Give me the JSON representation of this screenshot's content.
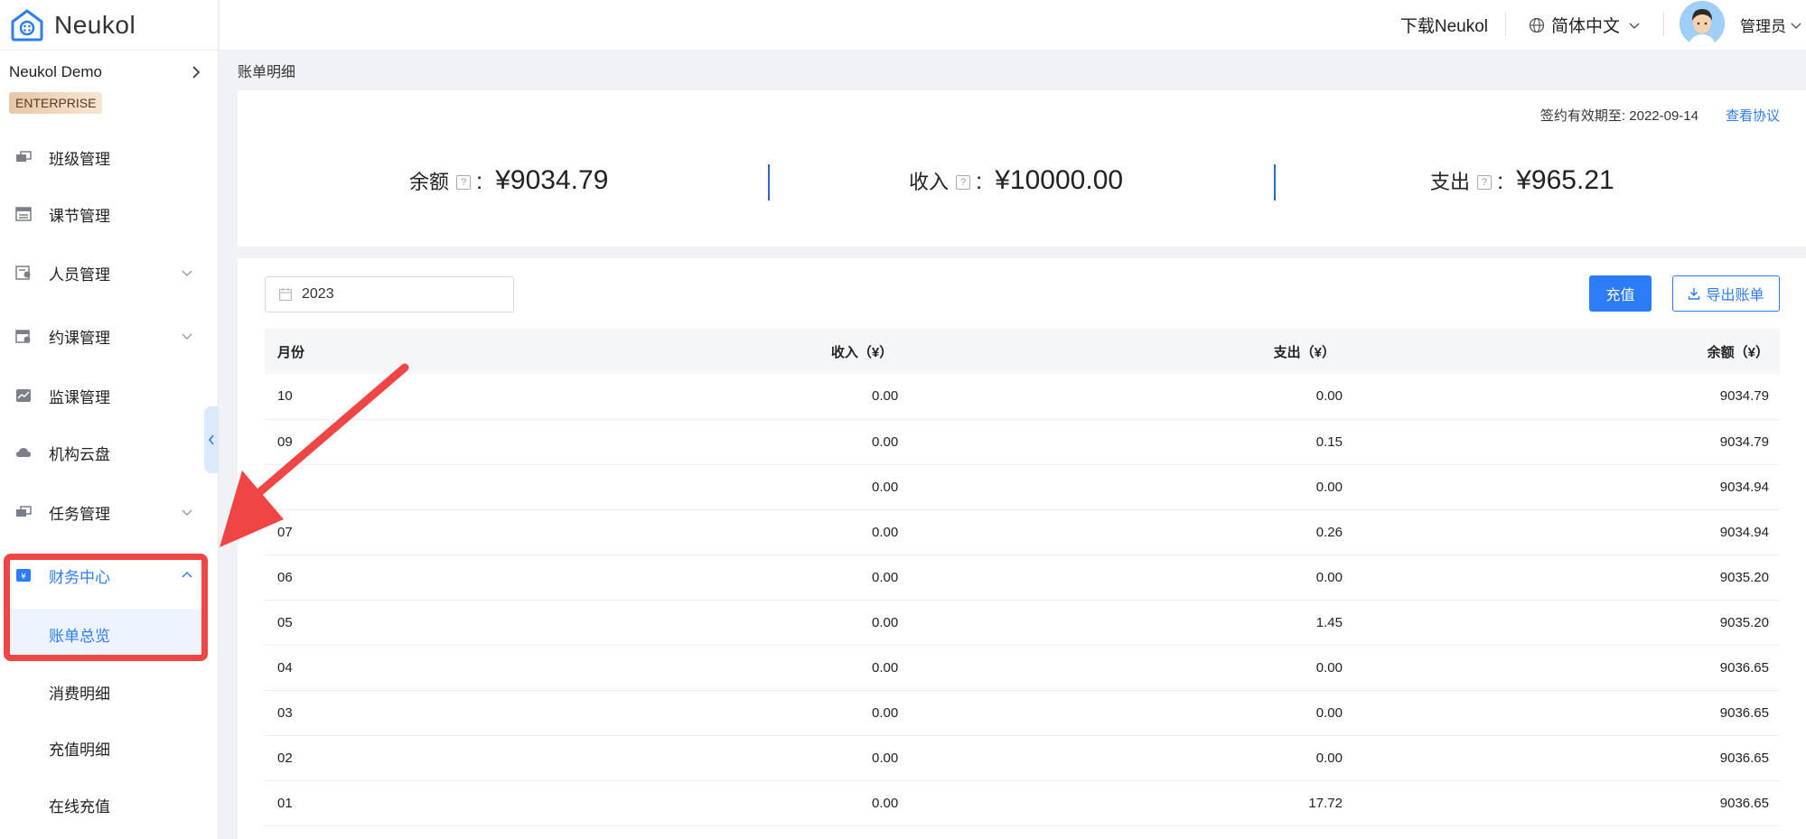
{
  "brand": {
    "name": "Neukol"
  },
  "sidebar": {
    "org_name": "Neukol Demo",
    "badge": "ENTERPRISE",
    "items": [
      {
        "label": "班级管理",
        "icon": "class-icon",
        "has_arrow": false
      },
      {
        "label": "课节管理",
        "icon": "lesson-icon",
        "has_arrow": false
      },
      {
        "label": "人员管理",
        "icon": "people-icon",
        "has_arrow": true
      },
      {
        "label": "约课管理",
        "icon": "booking-icon",
        "has_arrow": true
      },
      {
        "label": "监课管理",
        "icon": "monitor-icon",
        "has_arrow": false
      },
      {
        "label": "机构云盘",
        "icon": "cloud-icon",
        "has_arrow": false
      },
      {
        "label": "任务管理",
        "icon": "task-icon",
        "has_arrow": true
      },
      {
        "label": "财务中心",
        "icon": "finance-icon",
        "has_arrow": true,
        "expanded": true
      }
    ],
    "finance_sub": [
      "账单总览",
      "消费明细",
      "充值明细",
      "在线充值"
    ]
  },
  "header": {
    "download": "下载Neukol",
    "language": "简体中文",
    "user": "管理员"
  },
  "breadcrumb": "账单明细",
  "summary": {
    "contract_label": "签约有效期至: 2022-09-14",
    "view_link": "查看协议",
    "balance_label": "余额",
    "balance_value": "¥9034.79",
    "income_label": "收入",
    "income_value": "¥10000.00",
    "expense_label": "支出",
    "expense_value": "¥965.21"
  },
  "filters": {
    "year": "2023"
  },
  "actions": {
    "recharge": "充值",
    "export": "导出账单"
  },
  "table": {
    "headers": [
      "月份",
      "收入（¥）",
      "支出（¥）",
      "余额（¥）"
    ],
    "rows": [
      [
        "10",
        "0.00",
        "0.00",
        "9034.79"
      ],
      [
        "09",
        "0.00",
        "0.15",
        "9034.79"
      ],
      [
        "",
        "0.00",
        "0.00",
        "9034.94"
      ],
      [
        "07",
        "0.00",
        "0.26",
        "9034.94"
      ],
      [
        "06",
        "0.00",
        "0.00",
        "9035.20"
      ],
      [
        "05",
        "0.00",
        "1.45",
        "9035.20"
      ],
      [
        "04",
        "0.00",
        "0.00",
        "9036.65"
      ],
      [
        "03",
        "0.00",
        "0.00",
        "9036.65"
      ],
      [
        "02",
        "0.00",
        "0.00",
        "9036.65"
      ],
      [
        "01",
        "0.00",
        "17.72",
        "9036.65"
      ]
    ]
  },
  "colors": {
    "accent": "#2b7cf6",
    "annotation": "#ef4545"
  }
}
